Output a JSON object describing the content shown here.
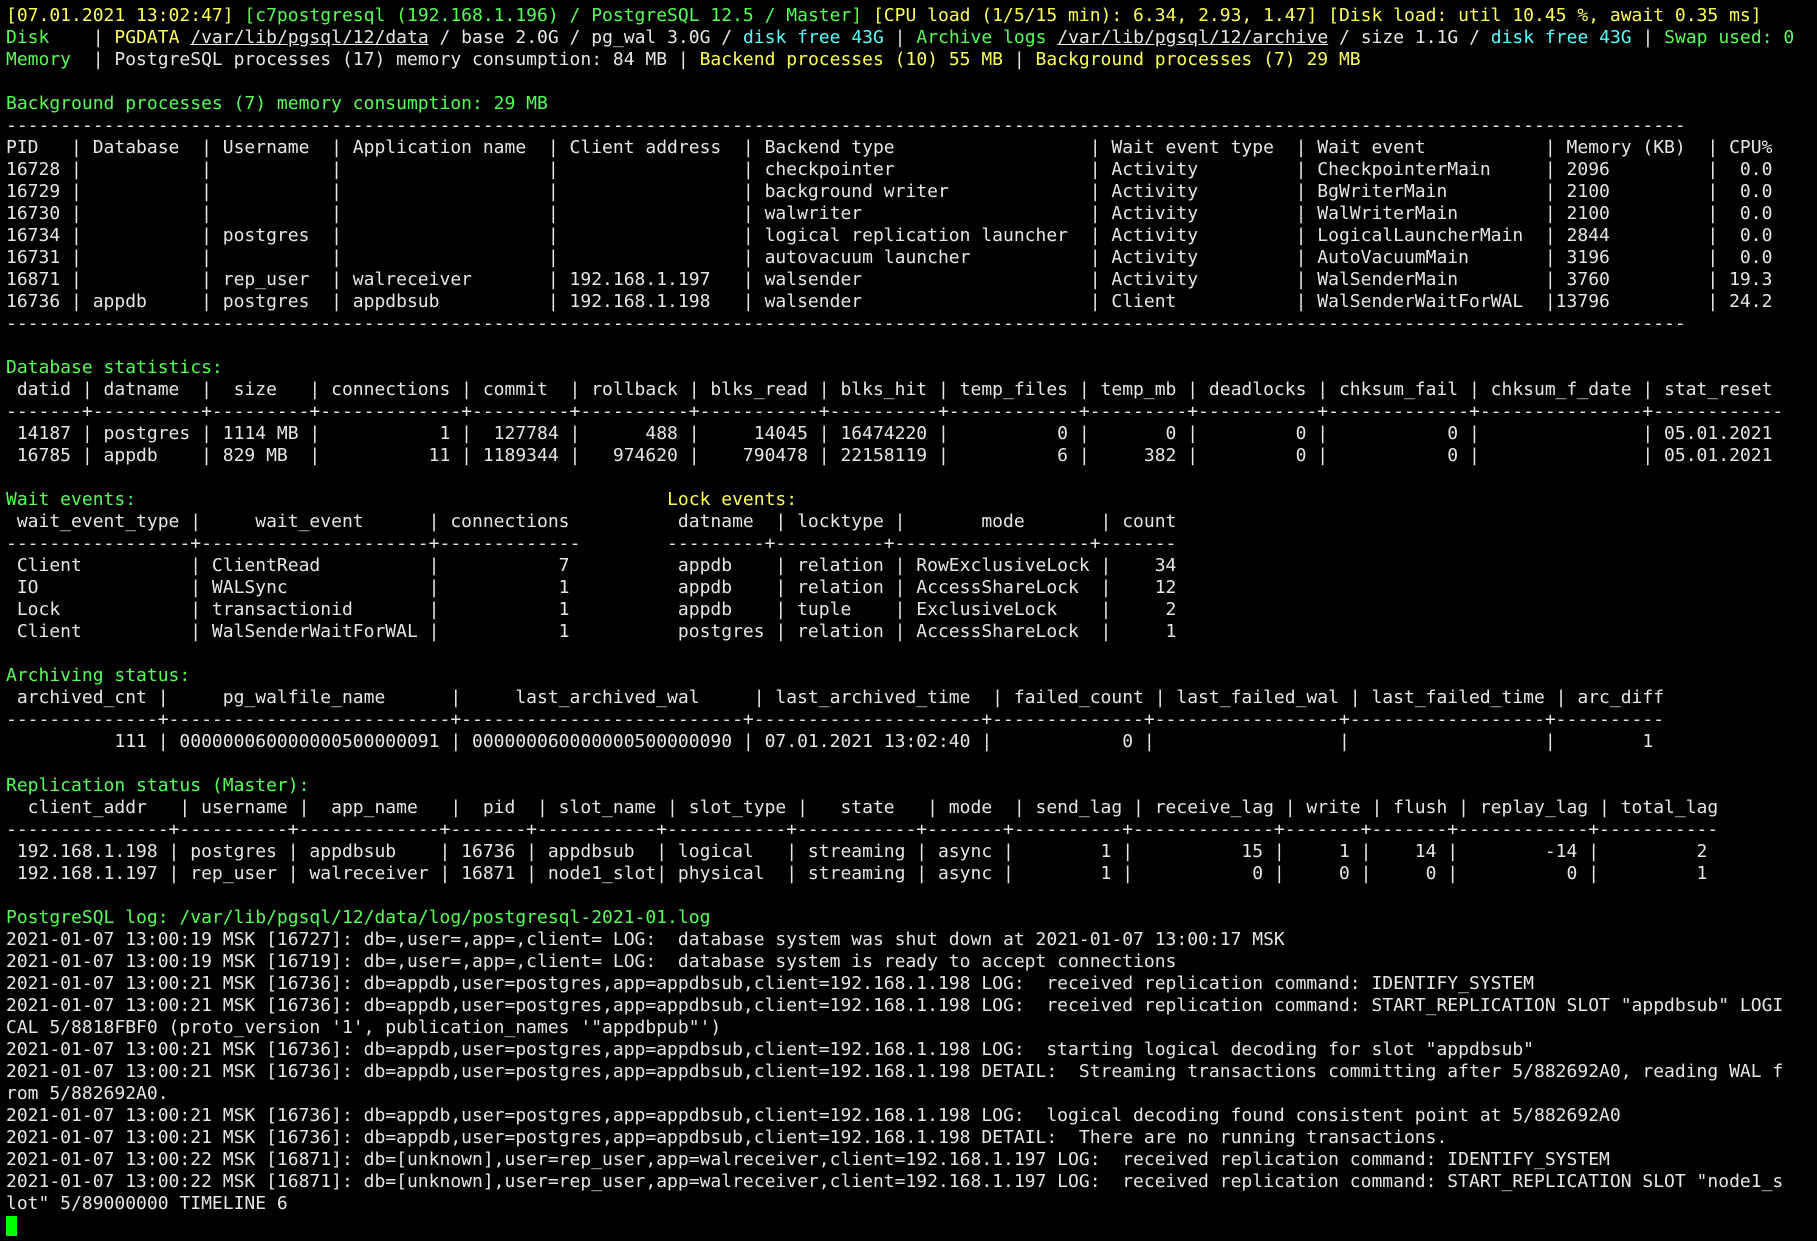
{
  "terminal": {
    "background": "#000000",
    "colors": {
      "default": "#e6e6e6",
      "yellow": "#ffff55",
      "green": "#55ff55",
      "cyan": "#55ffff"
    },
    "cursor_color": "#00ff00",
    "lines": [
      {
        "segs": [
          {
            "t": "[07.01.2021 13:02:47] ",
            "c": "y"
          },
          {
            "t": "[c7postgresql (192.168.1.196) / PostgreSQL 12.5 / Master] ",
            "c": "g"
          },
          {
            "t": "[CPU load (1/5/15 min): 6.34, 2.93, 1.47] [Disk load: util 10.45 %, await 0.35 ms]",
            "c": "y"
          }
        ]
      },
      {
        "segs": [
          {
            "t": "Disk",
            "c": "g"
          },
          {
            "t": "    | ",
            "c": "w"
          },
          {
            "t": "PGDATA ",
            "c": "y"
          },
          {
            "t": "/var/lib/pgsql/12/data",
            "c": "w",
            "u": true
          },
          {
            "t": " / base 2.0G / pg_wal 3.0G / ",
            "c": "w"
          },
          {
            "t": "disk free 43G",
            "c": "c"
          },
          {
            "t": " | ",
            "c": "w"
          },
          {
            "t": "Archive logs ",
            "c": "g"
          },
          {
            "t": "/var/lib/pgsql/12/archive",
            "c": "w",
            "u": true
          },
          {
            "t": " / size 1.1G / ",
            "c": "w"
          },
          {
            "t": "disk free 43G",
            "c": "c"
          },
          {
            "t": " | ",
            "c": "w"
          },
          {
            "t": "Swap used: 0",
            "c": "g"
          }
        ]
      },
      {
        "segs": [
          {
            "t": "Memory",
            "c": "g"
          },
          {
            "t": "  | PostgreSQL processes (17) memory consumption: 84 MB | ",
            "c": "w"
          },
          {
            "t": "Backend processes (10) 55 MB",
            "c": "y"
          },
          {
            "t": " | ",
            "c": "w"
          },
          {
            "t": "Background processes (7) 29 MB",
            "c": "y"
          }
        ]
      },
      {
        "segs": []
      },
      {
        "segs": [
          {
            "t": "Background processes (7) memory consumption: 29 MB",
            "c": "g"
          }
        ]
      },
      {
        "segs": [
          {
            "t": "-----------------------------------------------------------------------------------------------------------------------------------------------------------",
            "c": "w"
          }
        ]
      },
      {
        "segs": [
          {
            "t": "PID   | Database  | Username  | Application name  | Client address  | Backend type                  | Wait event type  | Wait event           | Memory (KB)  | CPU%",
            "c": "w"
          }
        ]
      },
      {
        "segs": [
          {
            "t": "16728 |           |           |                   |                 | checkpointer                  | Activity         | CheckpointerMain     | 2096         |  0.0",
            "c": "w"
          }
        ]
      },
      {
        "segs": [
          {
            "t": "16729 |           |           |                   |                 | background writer             | Activity         | BgWriterMain         | 2100         |  0.0",
            "c": "w"
          }
        ]
      },
      {
        "segs": [
          {
            "t": "16730 |           |           |                   |                 | walwriter                     | Activity         | WalWriterMain        | 2100         |  0.0",
            "c": "w"
          }
        ]
      },
      {
        "segs": [
          {
            "t": "16734 |           | postgres  |                   |                 | logical replication launcher  | Activity         | LogicalLauncherMain  | 2844         |  0.0",
            "c": "w"
          }
        ]
      },
      {
        "segs": [
          {
            "t": "16731 |           |           |                   |                 | autovacuum launcher           | Activity         | AutoVacuumMain       | 3196         |  0.0",
            "c": "w"
          }
        ]
      },
      {
        "segs": [
          {
            "t": "16871 |           | rep_user  | walreceiver       | 192.168.1.197   | walsender                     | Activity         | WalSenderMain        | 3760         | 19.3",
            "c": "w"
          }
        ]
      },
      {
        "segs": [
          {
            "t": "16736 | appdb     | postgres  | appdbsub          | 192.168.1.198   | walsender                     | Client           | WalSenderWaitForWAL  |13796         | 24.2",
            "c": "w"
          }
        ]
      },
      {
        "segs": [
          {
            "t": "-----------------------------------------------------------------------------------------------------------------------------------------------------------",
            "c": "w"
          }
        ]
      },
      {
        "segs": []
      },
      {
        "segs": [
          {
            "t": "Database statistics:",
            "c": "g"
          }
        ]
      },
      {
        "segs": [
          {
            "t": " datid | datname  |  size   | connections | commit  | rollback | blks_read | blks_hit | temp_files | temp_mb | deadlocks | chksum_fail | chksum_f_date | stat_reset",
            "c": "w"
          }
        ]
      },
      {
        "segs": [
          {
            "t": "-------+----------+---------+-------------+---------+----------+-----------+----------+------------+---------+-----------+-------------+---------------+------------",
            "c": "w"
          }
        ]
      },
      {
        "segs": [
          {
            "t": " 14187 | postgres | 1114 MB |           1 |  127784 |      488 |     14045 | 16474220 |          0 |       0 |         0 |           0 |               | 05.01.2021",
            "c": "w"
          }
        ]
      },
      {
        "segs": [
          {
            "t": " 16785 | appdb    | 829 MB  |          11 | 1189344 |   974620 |    790478 | 22158119 |          6 |     382 |         0 |           0 |               | 05.01.2021",
            "c": "w"
          }
        ]
      },
      {
        "segs": []
      },
      {
        "segs": [
          {
            "t": "Wait events:",
            "c": "g"
          },
          {
            "t": "                                                 ",
            "c": "w"
          },
          {
            "t": "Lock events:",
            "c": "y"
          }
        ]
      },
      {
        "segs": [
          {
            "t": " wait_event_type |     wait_event      | connections          datname  | locktype |       mode       | count",
            "c": "w"
          }
        ]
      },
      {
        "segs": [
          {
            "t": "-----------------+---------------------+-------------        ---------+----------+------------------+-------",
            "c": "w"
          }
        ]
      },
      {
        "segs": [
          {
            "t": " Client          | ClientRead          |           7          appdb    | relation | RowExclusiveLock |    34",
            "c": "w"
          }
        ]
      },
      {
        "segs": [
          {
            "t": " IO              | WALSync             |           1          appdb    | relation | AccessShareLock  |    12",
            "c": "w"
          }
        ]
      },
      {
        "segs": [
          {
            "t": " Lock            | transactionid       |           1          appdb    | tuple    | ExclusiveLock    |     2",
            "c": "w"
          }
        ]
      },
      {
        "segs": [
          {
            "t": " Client          | WalSenderWaitForWAL |           1          postgres | relation | AccessShareLock  |     1",
            "c": "w"
          }
        ]
      },
      {
        "segs": []
      },
      {
        "segs": [
          {
            "t": "Archiving status:",
            "c": "g"
          }
        ]
      },
      {
        "segs": [
          {
            "t": " archived_cnt |     pg_walfile_name      |     last_archived_wal     | last_archived_time  | failed_count | last_failed_wal | last_failed_time | arc_diff",
            "c": "w"
          }
        ]
      },
      {
        "segs": [
          {
            "t": "--------------+--------------------------+--------------------------+---------------------+--------------+-----------------+------------------+----------",
            "c": "w"
          }
        ]
      },
      {
        "segs": [
          {
            "t": "          111 | 000000060000000500000091 | 000000060000000500000090 | 07.01.2021 13:02:40 |            0 |                 |                  |        1",
            "c": "w"
          }
        ]
      },
      {
        "segs": []
      },
      {
        "segs": [
          {
            "t": "Replication status (Master):",
            "c": "g"
          }
        ]
      },
      {
        "segs": [
          {
            "t": "  client_addr   | username |  app_name   |  pid  | slot_name | slot_type |   state   | mode  | send_lag | receive_lag | write | flush | replay_lag | total_lag",
            "c": "w"
          }
        ]
      },
      {
        "segs": [
          {
            "t": "---------------+----------+-------------+-------+-----------+-----------+-----------+-------+----------+-------------+-------+-------+------------+-----------",
            "c": "w"
          }
        ]
      },
      {
        "segs": [
          {
            "t": " 192.168.1.198 | postgres | appdbsub    | 16736 | appdbsub  | logical   | streaming | async |        1 |          15 |     1 |    14 |        -14 |         2",
            "c": "w"
          }
        ]
      },
      {
        "segs": [
          {
            "t": " 192.168.1.197 | rep_user | walreceiver | 16871 | node1_slot| physical  | streaming | async |        1 |           0 |     0 |     0 |          0 |         1",
            "c": "w"
          }
        ]
      },
      {
        "segs": []
      },
      {
        "segs": [
          {
            "t": "PostgreSQL log: /var/lib/pgsql/12/data/log/postgresql-2021-01.log",
            "c": "g"
          }
        ]
      },
      {
        "segs": [
          {
            "t": "2021-01-07 13:00:19 MSK [16727]: db=,user=,app=,client= LOG:  database system was shut down at 2021-01-07 13:00:17 MSK",
            "c": "w"
          }
        ]
      },
      {
        "segs": [
          {
            "t": "2021-01-07 13:00:19 MSK [16719]: db=,user=,app=,client= LOG:  database system is ready to accept connections",
            "c": "w"
          }
        ]
      },
      {
        "segs": [
          {
            "t": "2021-01-07 13:00:21 MSK [16736]: db=appdb,user=postgres,app=appdbsub,client=192.168.1.198 LOG:  received replication command: IDENTIFY_SYSTEM",
            "c": "w"
          }
        ]
      },
      {
        "segs": [
          {
            "t": "2021-01-07 13:00:21 MSK [16736]: db=appdb,user=postgres,app=appdbsub,client=192.168.1.198 LOG:  received replication command: START_REPLICATION SLOT \"appdbsub\" LOGI",
            "c": "w"
          }
        ]
      },
      {
        "segs": [
          {
            "t": "CAL 5/8818FBF0 (proto_version '1', publication_names '\"appdbpub\"')",
            "c": "w"
          }
        ]
      },
      {
        "segs": [
          {
            "t": "2021-01-07 13:00:21 MSK [16736]: db=appdb,user=postgres,app=appdbsub,client=192.168.1.198 LOG:  starting logical decoding for slot \"appdbsub\"",
            "c": "w"
          }
        ]
      },
      {
        "segs": [
          {
            "t": "2021-01-07 13:00:21 MSK [16736]: db=appdb,user=postgres,app=appdbsub,client=192.168.1.198 DETAIL:  Streaming transactions committing after 5/882692A0, reading WAL f",
            "c": "w"
          }
        ]
      },
      {
        "segs": [
          {
            "t": "rom 5/882692A0.",
            "c": "w"
          }
        ]
      },
      {
        "segs": [
          {
            "t": "2021-01-07 13:00:21 MSK [16736]: db=appdb,user=postgres,app=appdbsub,client=192.168.1.198 LOG:  logical decoding found consistent point at 5/882692A0",
            "c": "w"
          }
        ]
      },
      {
        "segs": [
          {
            "t": "2021-01-07 13:00:21 MSK [16736]: db=appdb,user=postgres,app=appdbsub,client=192.168.1.198 DETAIL:  There are no running transactions.",
            "c": "w"
          }
        ]
      },
      {
        "segs": [
          {
            "t": "2021-01-07 13:00:22 MSK [16871]: db=[unknown],user=rep_user,app=walreceiver,client=192.168.1.197 LOG:  received replication command: IDENTIFY_SYSTEM",
            "c": "w"
          }
        ]
      },
      {
        "segs": [
          {
            "t": "2021-01-07 13:00:22 MSK [16871]: db=[unknown],user=rep_user,app=walreceiver,client=192.168.1.197 LOG:  received replication command: START_REPLICATION SLOT \"node1_s",
            "c": "w"
          }
        ]
      },
      {
        "segs": [
          {
            "t": "lot\" 5/89000000 TIMELINE 6",
            "c": "w"
          }
        ]
      }
    ]
  }
}
